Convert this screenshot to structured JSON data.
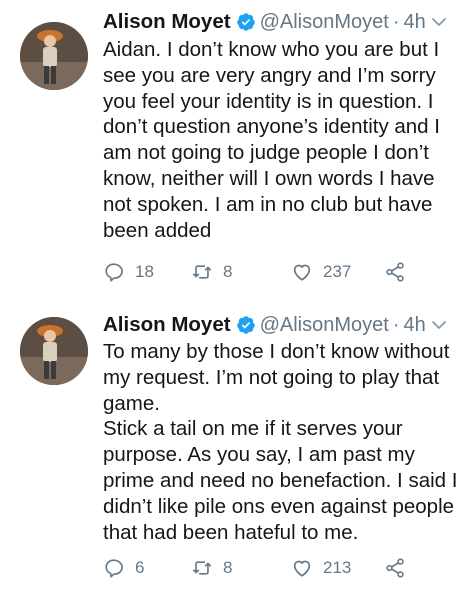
{
  "tweets": [
    {
      "name": "Alison Moyet",
      "handle": "@AlisonMoyet",
      "separator": "·",
      "time": "4h",
      "text": "Aidan. I don’t know who you are but I see you are very angry and I’m sorry you feel your identity is in question. I don’t question anyone’s identity and I am not going to judge people I don’t know, neither will I own words I have not spoken. I am in no club but have been added",
      "replies": "18",
      "retweets": "8",
      "likes": "237"
    },
    {
      "name": "Alison Moyet",
      "handle": "@AlisonMoyet",
      "separator": "·",
      "time": "4h",
      "text": "To many by those I don’t know without my request. I’m not going to play that game.\nStick a tail on me if it serves your purpose. As you say, I am past my prime and need no benefaction. I said I didn’t like pile ons even against people that had been hateful to me.",
      "replies": "6",
      "retweets": "8",
      "likes": "213"
    }
  ],
  "icons": {
    "verified": "verified-badge-icon",
    "chevron": "chevron-down-icon",
    "reply": "reply-icon",
    "retweet": "retweet-icon",
    "like": "heart-icon",
    "share": "share-icon"
  },
  "colors": {
    "text": "#14171a",
    "secondary": "#657786",
    "verified": "#1da1f2"
  }
}
